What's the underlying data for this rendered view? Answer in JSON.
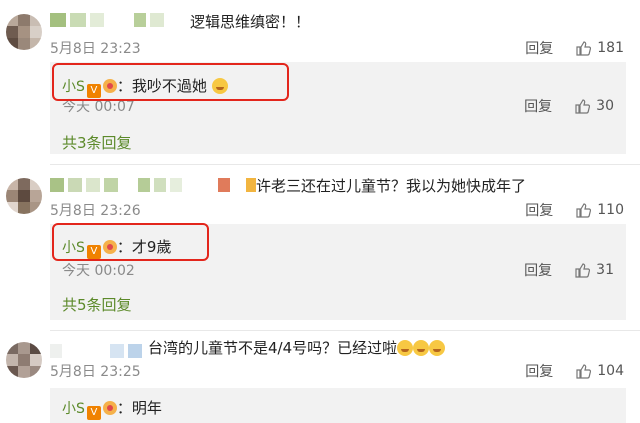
{
  "comments": [
    {
      "text": "逻辑思维缜密！！",
      "date": "5月8日",
      "time": "23:23",
      "reply_label": "回复",
      "likes": "181",
      "reply": {
        "name": "小S",
        "colon": "：",
        "text": "我吵不過她",
        "time_prefix": "今天",
        "time": "00:07",
        "reply_label": "回复",
        "likes": "30"
      },
      "more": "共3条回复"
    },
    {
      "text": "许老三还在过儿童节？我以为她快成年了",
      "date": "5月8日",
      "time": "23:26",
      "reply_label": "回复",
      "likes": "110",
      "reply": {
        "name": "小S",
        "colon": "：",
        "text": "才9歲",
        "time_prefix": "今天",
        "time": "00:02",
        "reply_label": "回复",
        "likes": "31"
      },
      "more": "共5条回复"
    },
    {
      "text": "台湾的儿童节不是4/4号吗？已经过啦",
      "date": "5月8日",
      "time": "23:25",
      "reply_label": "回复",
      "likes": "104",
      "reply": {
        "name": "小S",
        "colon": "：",
        "text": "明年"
      }
    }
  ],
  "badges": {
    "verified": "V"
  },
  "colors": {
    "link_green": "#5c8a2a",
    "highlight_red": "#e3261c",
    "reply_bg": "#f2f2f2"
  }
}
